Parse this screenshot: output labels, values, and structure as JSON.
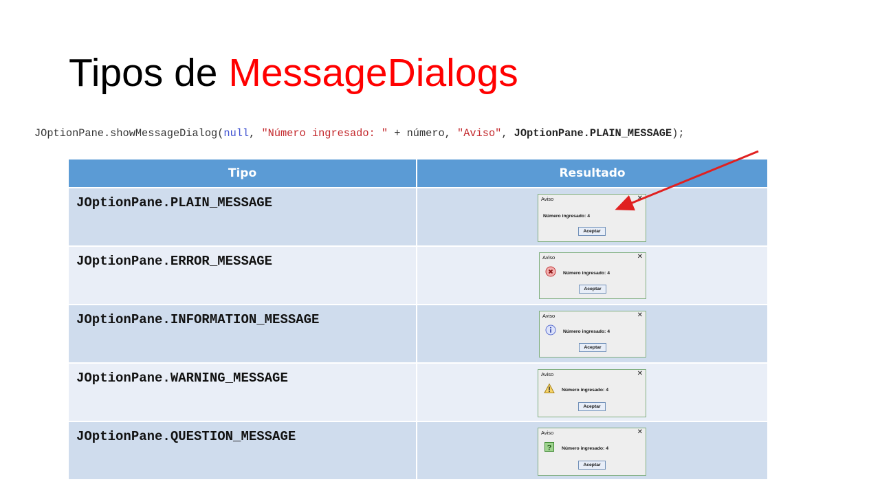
{
  "title": {
    "plain": "Tipos de ",
    "accent": "MessageDialogs"
  },
  "code_line": {
    "p1": "JOptionPane.showMessageDialog(",
    "kw_null": "null",
    "p2": ", ",
    "str1": "\"Número ingresado: \"",
    "p3": " + número, ",
    "str2": "\"Aviso\"",
    "p4": ", ",
    "const": "JOptionPane.PLAIN_MESSAGE",
    "p5": ");"
  },
  "table": {
    "headers": {
      "type": "Tipo",
      "result": "Resultado"
    },
    "rows": [
      {
        "type": "JOptionPane.PLAIN_MESSAGE",
        "icon": "none"
      },
      {
        "type": "JOptionPane.ERROR_MESSAGE",
        "icon": "error-icon"
      },
      {
        "type": "JOptionPane.INFORMATION_MESSAGE",
        "icon": "information-icon"
      },
      {
        "type": "JOptionPane.WARNING_MESSAGE",
        "icon": "warning-icon"
      },
      {
        "type": "JOptionPane.QUESTION_MESSAGE",
        "icon": "question-icon"
      }
    ]
  },
  "dialog": {
    "title": "Aviso",
    "close": "✕",
    "message": "Número ingresado: 4",
    "button": "Aceptar"
  },
  "colors": {
    "accent_red": "#ff0000",
    "header_blue": "#5b9bd5",
    "row_odd": "#cfdced",
    "row_even": "#e9eef7",
    "arrow": "#e02020"
  }
}
